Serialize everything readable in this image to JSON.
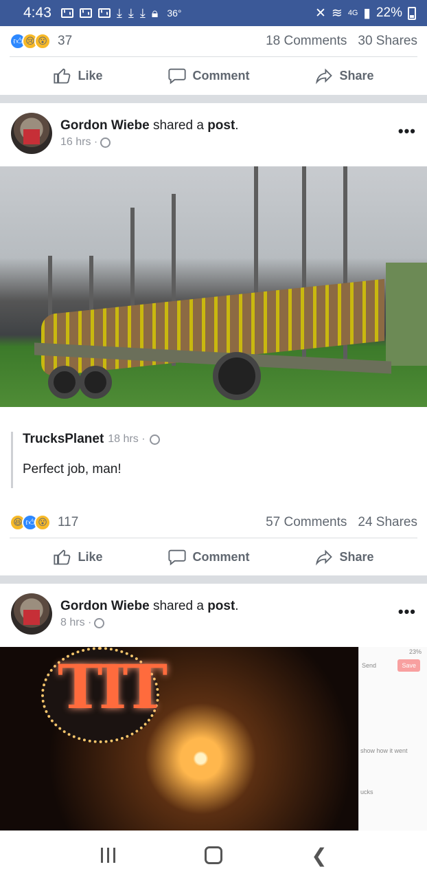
{
  "statusbar": {
    "time": "4:43",
    "temp": "36°",
    "network": "4G",
    "battery": "22%"
  },
  "post0": {
    "reaction_count": "37",
    "comments": "18 Comments",
    "shares": "30 Shares",
    "like": "Like",
    "comment": "Comment",
    "share": "Share"
  },
  "post1": {
    "author": "Gordon Wiebe",
    "action_text": "shared a",
    "post_word": "post",
    "time": "16 hrs ·",
    "shared_page": "TrucksPlanet",
    "shared_time": "18 hrs ·",
    "shared_text": "Perfect job, man!",
    "reaction_count": "117",
    "comments": "57 Comments",
    "shares": "24 Shares",
    "like": "Like",
    "comment": "Comment",
    "share": "Share"
  },
  "post2": {
    "author": "Gordon Wiebe",
    "action_text": "shared a",
    "post_word": "post",
    "time": "8 hrs ·",
    "sign": "TIT",
    "overlay_send": "Send",
    "overlay_save": "Save",
    "overlay_battery": "23%",
    "overlay_hint": "show how it went",
    "overlay_item": "ucks"
  },
  "icons": {
    "home": "home-icon",
    "recents": "recents-icon",
    "back": "back-icon"
  }
}
